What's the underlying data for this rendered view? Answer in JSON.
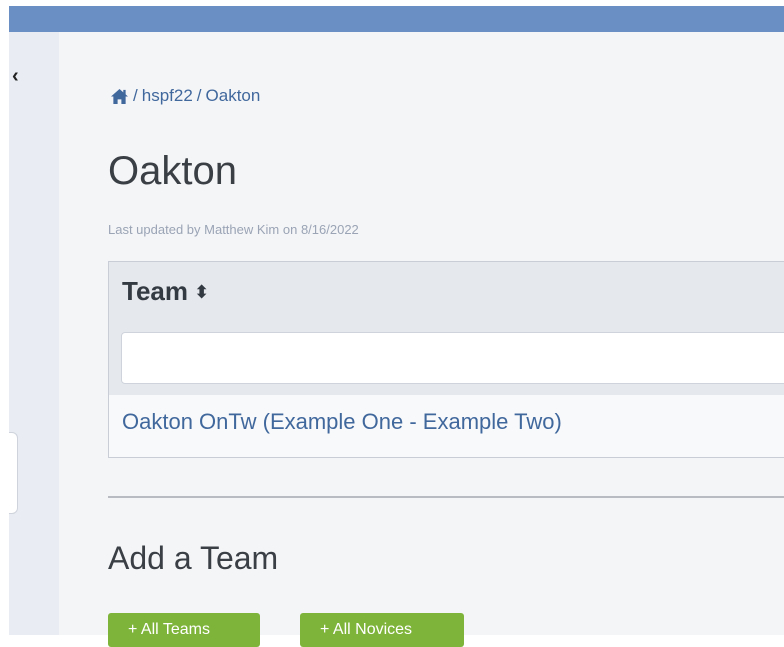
{
  "breadcrumb": {
    "home_icon": "home-icon",
    "separator": "/",
    "items": [
      "hspf22",
      "Oakton"
    ]
  },
  "page": {
    "title": "Oakton",
    "updated": "Last updated by Matthew Kim on 8/16/2022"
  },
  "table": {
    "column_header": "Team",
    "sort_icon": "sort-icon",
    "filter_value": "",
    "rows": [
      {
        "team": "Oakton OnTw (Example One - Example Two)"
      }
    ]
  },
  "add_team": {
    "title": "Add a Team",
    "buttons": [
      "+ All Teams",
      "+ All Novices"
    ]
  },
  "sidebar": {
    "collapse_icon": "chevron-left-icon"
  },
  "colors": {
    "topbar": "#6a8fc4",
    "link": "#41689d",
    "button": "#7fb43a"
  }
}
